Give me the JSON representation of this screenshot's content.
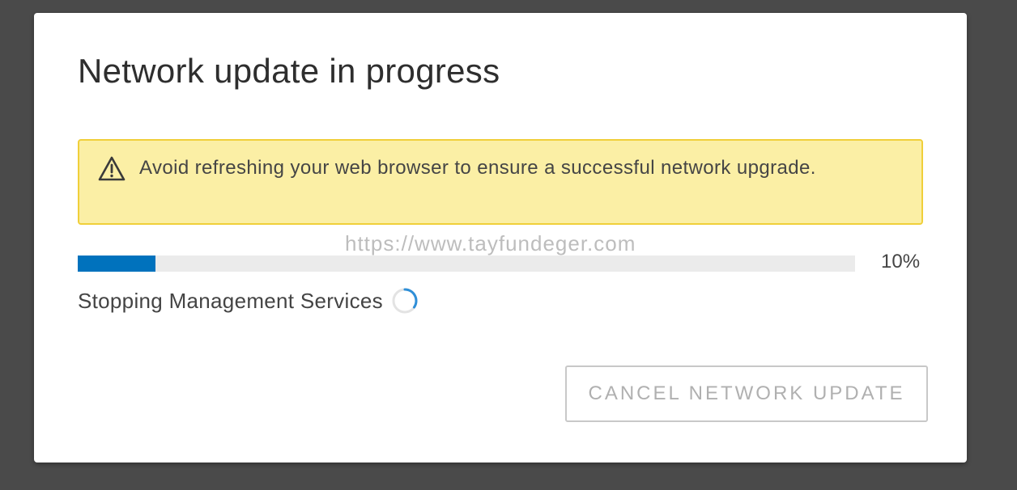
{
  "dialog": {
    "title": "Network update in progress",
    "alert": {
      "icon": "warning-triangle-icon",
      "message": "Avoid refreshing your web browser to ensure a successful network upgrade.",
      "background_color": "#fbefa5",
      "border_color": "#f0cf3a"
    },
    "watermark": "https://www.tayfundeger.com",
    "progress": {
      "value_percent": 10,
      "label": "10%",
      "fill_color": "#0072bd"
    },
    "status": {
      "text": "Stopping Management Services",
      "icon": "loading-spinner-icon"
    },
    "cancel_button": {
      "label": "CANCEL NETWORK UPDATE",
      "disabled": true
    }
  }
}
